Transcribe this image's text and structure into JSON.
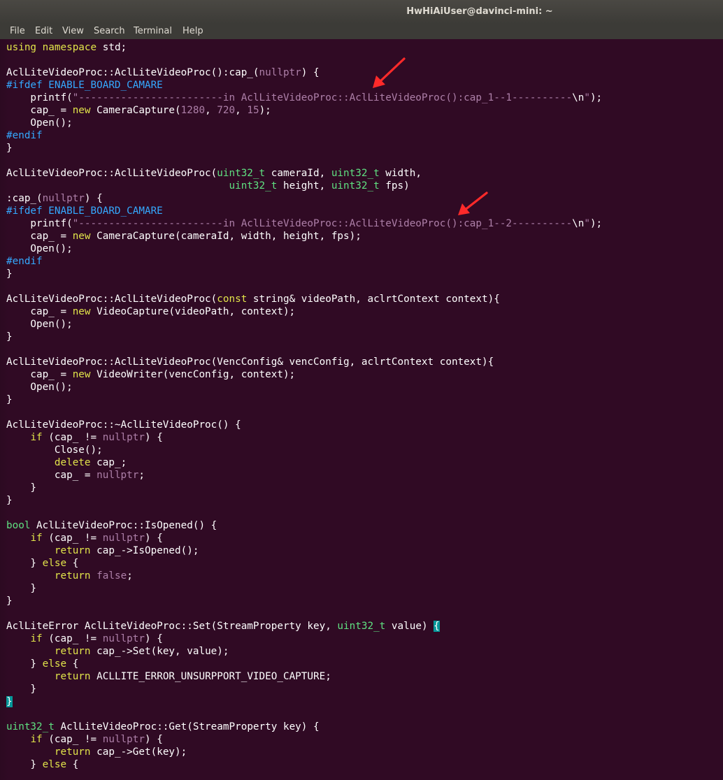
{
  "window": {
    "title": "HwHiAiUser@davinci-mini: ~"
  },
  "menu": {
    "file": "File",
    "edit": "Edit",
    "view": "View",
    "search": "Search",
    "terminal": "Terminal",
    "help": "Help"
  },
  "colors": {
    "background": "#300a24",
    "keyword": "#e1e44a",
    "type": "#5fe081",
    "constant": "#ad7fa8",
    "preprocessor": "#34a9ff",
    "annotation_arrow": "#ff2a2a"
  },
  "annotations": [
    "red-arrow",
    "red-arrow"
  ],
  "code_lines": [
    [
      [
        "kw",
        "using"
      ],
      [
        "t",
        " "
      ],
      [
        "kw",
        "namespace"
      ],
      [
        "t",
        " std;"
      ]
    ],
    [],
    [
      [
        "t",
        "AclLiteVideoProc::AclLiteVideoProc():cap_("
      ],
      [
        "cn",
        "nullptr"
      ],
      [
        "t",
        ") {"
      ]
    ],
    [
      [
        "pp",
        "#ifdef ENABLE_BOARD_CAMARE"
      ]
    ],
    [
      [
        "t",
        "    printf("
      ],
      [
        "st",
        "\"------------------------in AclLiteVideoProc::AclLiteVideoProc():cap_1--1----------"
      ],
      [
        "t",
        "\\n"
      ],
      [
        "st",
        "\""
      ],
      [
        "t",
        ");"
      ]
    ],
    [
      [
        "t",
        "    cap_ = "
      ],
      [
        "kw",
        "new"
      ],
      [
        "t",
        " CameraCapture("
      ],
      [
        "cn",
        "1280"
      ],
      [
        "t",
        ", "
      ],
      [
        "cn",
        "720"
      ],
      [
        "t",
        ", "
      ],
      [
        "cn",
        "15"
      ],
      [
        "t",
        ");"
      ]
    ],
    [
      [
        "t",
        "    Open();"
      ]
    ],
    [
      [
        "pp",
        "#endif"
      ]
    ],
    [
      [
        "t",
        "}"
      ]
    ],
    [],
    [
      [
        "t",
        "AclLiteVideoProc::AclLiteVideoProc("
      ],
      [
        "ty",
        "uint32_t"
      ],
      [
        "t",
        " cameraId, "
      ],
      [
        "ty",
        "uint32_t"
      ],
      [
        "t",
        " width,"
      ]
    ],
    [
      [
        "t",
        "                                     "
      ],
      [
        "ty",
        "uint32_t"
      ],
      [
        "t",
        " height, "
      ],
      [
        "ty",
        "uint32_t"
      ],
      [
        "t",
        " fps)"
      ]
    ],
    [
      [
        "t",
        ":cap_("
      ],
      [
        "cn",
        "nullptr"
      ],
      [
        "t",
        ") {"
      ]
    ],
    [
      [
        "pp",
        "#ifdef ENABLE_BOARD_CAMARE"
      ]
    ],
    [
      [
        "t",
        "    printf("
      ],
      [
        "st",
        "\"------------------------in AclLiteVideoProc::AclLiteVideoProc():cap_1--2----------"
      ],
      [
        "t",
        "\\n"
      ],
      [
        "st",
        "\""
      ],
      [
        "t",
        ");"
      ]
    ],
    [
      [
        "t",
        "    cap_ = "
      ],
      [
        "kw",
        "new"
      ],
      [
        "t",
        " CameraCapture(cameraId, width, height, fps);"
      ]
    ],
    [
      [
        "t",
        "    Open();"
      ]
    ],
    [
      [
        "pp",
        "#endif"
      ]
    ],
    [
      [
        "t",
        "}"
      ]
    ],
    [],
    [
      [
        "t",
        "AclLiteVideoProc::AclLiteVideoProc("
      ],
      [
        "kw",
        "const"
      ],
      [
        "t",
        " string& videoPath, aclrtContext context){"
      ]
    ],
    [
      [
        "t",
        "    cap_ = "
      ],
      [
        "kw",
        "new"
      ],
      [
        "t",
        " VideoCapture(videoPath, context);"
      ]
    ],
    [
      [
        "t",
        "    Open();"
      ]
    ],
    [
      [
        "t",
        "}"
      ]
    ],
    [],
    [
      [
        "t",
        "AclLiteVideoProc::AclLiteVideoProc(VencConfig& vencConfig, aclrtContext context){"
      ]
    ],
    [
      [
        "t",
        "    cap_ = "
      ],
      [
        "kw",
        "new"
      ],
      [
        "t",
        " VideoWriter(vencConfig, context);"
      ]
    ],
    [
      [
        "t",
        "    Open();"
      ]
    ],
    [
      [
        "t",
        "}"
      ]
    ],
    [],
    [
      [
        "t",
        "AclLiteVideoProc::~AclLiteVideoProc() {"
      ]
    ],
    [
      [
        "t",
        "    "
      ],
      [
        "kw",
        "if"
      ],
      [
        "t",
        " (cap_ != "
      ],
      [
        "cn",
        "nullptr"
      ],
      [
        "t",
        ") {"
      ]
    ],
    [
      [
        "t",
        "        Close();"
      ]
    ],
    [
      [
        "t",
        "        "
      ],
      [
        "kw",
        "delete"
      ],
      [
        "t",
        " cap_;"
      ]
    ],
    [
      [
        "t",
        "        cap_ = "
      ],
      [
        "cn",
        "nullptr"
      ],
      [
        "t",
        ";"
      ]
    ],
    [
      [
        "t",
        "    }"
      ]
    ],
    [
      [
        "t",
        "}"
      ]
    ],
    [],
    [
      [
        "ty",
        "bool"
      ],
      [
        "t",
        " AclLiteVideoProc::IsOpened() {"
      ]
    ],
    [
      [
        "t",
        "    "
      ],
      [
        "kw",
        "if"
      ],
      [
        "t",
        " (cap_ != "
      ],
      [
        "cn",
        "nullptr"
      ],
      [
        "t",
        ") {"
      ]
    ],
    [
      [
        "t",
        "        "
      ],
      [
        "kw",
        "return"
      ],
      [
        "t",
        " cap_->IsOpened();"
      ]
    ],
    [
      [
        "t",
        "    } "
      ],
      [
        "kw",
        "else"
      ],
      [
        "t",
        " {"
      ]
    ],
    [
      [
        "t",
        "        "
      ],
      [
        "kw",
        "return"
      ],
      [
        "t",
        " "
      ],
      [
        "cn",
        "false"
      ],
      [
        "t",
        ";"
      ]
    ],
    [
      [
        "t",
        "    }"
      ]
    ],
    [
      [
        "t",
        "}"
      ]
    ],
    [],
    [
      [
        "t",
        "AclLiteError AclLiteVideoProc::Set(StreamProperty key, "
      ],
      [
        "ty",
        "uint32_t"
      ],
      [
        "t",
        " value) "
      ],
      [
        "cursor",
        "{"
      ]
    ],
    [
      [
        "t",
        "    "
      ],
      [
        "kw",
        "if"
      ],
      [
        "t",
        " (cap_ != "
      ],
      [
        "cn",
        "nullptr"
      ],
      [
        "t",
        ") {"
      ]
    ],
    [
      [
        "t",
        "        "
      ],
      [
        "kw",
        "return"
      ],
      [
        "t",
        " cap_->Set(key, value);"
      ]
    ],
    [
      [
        "t",
        "    } "
      ],
      [
        "kw",
        "else"
      ],
      [
        "t",
        " {"
      ]
    ],
    [
      [
        "t",
        "        "
      ],
      [
        "kw",
        "return"
      ],
      [
        "t",
        " ACLLITE_ERROR_UNSURPPORT_VIDEO_CAPTURE;"
      ]
    ],
    [
      [
        "t",
        "    }"
      ]
    ],
    [
      [
        "cursor",
        "}"
      ]
    ],
    [],
    [
      [
        "ty",
        "uint32_t"
      ],
      [
        "t",
        " AclLiteVideoProc::Get(StreamProperty key) {"
      ]
    ],
    [
      [
        "t",
        "    "
      ],
      [
        "kw",
        "if"
      ],
      [
        "t",
        " (cap_ != "
      ],
      [
        "cn",
        "nullptr"
      ],
      [
        "t",
        ") {"
      ]
    ],
    [
      [
        "t",
        "        "
      ],
      [
        "kw",
        "return"
      ],
      [
        "t",
        " cap_->Get(key);"
      ]
    ],
    [
      [
        "t",
        "    } "
      ],
      [
        "kw",
        "else"
      ],
      [
        "t",
        " {"
      ]
    ]
  ]
}
